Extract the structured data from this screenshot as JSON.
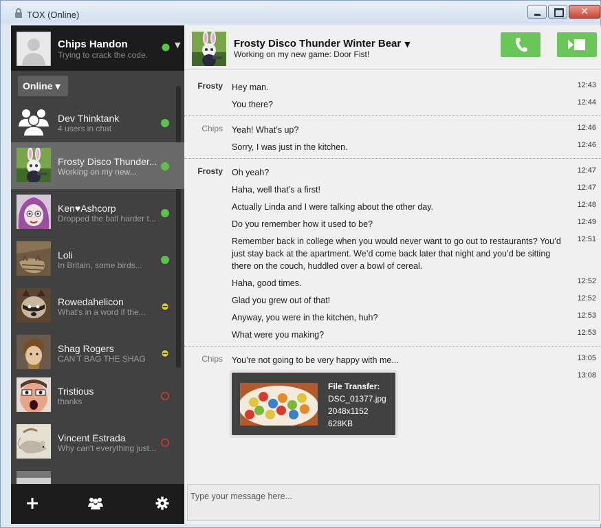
{
  "window": {
    "title": "TOX (Online)"
  },
  "self": {
    "name": "Chips Handon",
    "status": "Trying to crack the code.",
    "status_color": "#5cc24a"
  },
  "status_dropdown": {
    "label": "Online ▾"
  },
  "friends": [
    {
      "name": "Dev Thinktank",
      "status": "4 users in chat",
      "dot": "online",
      "avatar": "group-avatar"
    },
    {
      "name": "Frosty Disco Thunder...",
      "status": "Working on my new...",
      "dot": "online",
      "avatar": "bunny-avatar"
    },
    {
      "name": "Ken♥Ashcorp",
      "status": "Dropped the ball harder t...",
      "dot": "online",
      "avatar": "anime-avatar"
    },
    {
      "name": "Loli",
      "status": "In Britain, some birds...",
      "dot": "online",
      "avatar": "cat-avatar"
    },
    {
      "name": "Rowedahelicon",
      "status": "What's in a word if the...",
      "dot": "away",
      "avatar": "raccoon-avatar"
    },
    {
      "name": "Shag Rogers",
      "status": "CAN'T BAG THE SHAG",
      "dot": "away",
      "avatar": "shaggy-avatar"
    },
    {
      "name": "Tristious",
      "status": "thanks",
      "dot": "busy",
      "avatar": "face-avatar"
    },
    {
      "name": "Vincent Estrada",
      "status": "Why can't everything just...",
      "dot": "busy",
      "avatar": "mouse-avatar"
    }
  ],
  "colors": {
    "online": "#5cc24a",
    "away": "#e3cf2b",
    "busy": "#c9393b",
    "accent": "#6bc65a"
  },
  "chat": {
    "name": "Frosty Disco Thunder Winter Bear",
    "status": "Working on my new game: Door Fist!"
  },
  "messages": [
    {
      "who": "Frosty",
      "text": "Hey man.",
      "time": "12:43"
    },
    {
      "who": "",
      "text": "You there?",
      "time": "12:44"
    },
    {
      "who": "Chips",
      "text": "Yeah! What’s up?",
      "time": "12:46"
    },
    {
      "who": "",
      "text": "Sorry, I was just in the kitchen.",
      "time": "12:46"
    },
    {
      "who": "Frosty",
      "text": "Oh yeah?",
      "time": "12:47"
    },
    {
      "who": "",
      "text": "Haha, well that’s a first!",
      "time": "12:47"
    },
    {
      "who": "",
      "text": "Actually Linda and I were talking about the other day.",
      "time": "12:48"
    },
    {
      "who": "",
      "text": "Do you remember how it used to be?",
      "time": "12:49"
    },
    {
      "who": "",
      "text": "Remember back in college when you would never want to go out to restaurants? You’d just stay back at the apartment. We’d come back later that night and you’d be sitting there on the couch, huddled over a bowl of cereal.",
      "time": "12:51"
    },
    {
      "who": "",
      "text": "Haha, good times.",
      "time": "12:52"
    },
    {
      "who": "",
      "text": "Glad you grew out of that!",
      "time": "12:52"
    },
    {
      "who": "",
      "text": "Anyway, you were in the kitchen, huh?",
      "time": "12:53"
    },
    {
      "who": "",
      "text": "What were you making?",
      "time": "12:53"
    },
    {
      "who": "Chips",
      "text": "You’re not going to be very happy with me...",
      "time": "13:05"
    },
    {
      "who": "",
      "text": "",
      "time": "13:08"
    }
  ],
  "file_transfer": {
    "title": "File Transfer:",
    "filename": "DSC_01377.jpg",
    "dimensions": "2048x1152",
    "size": "628KB"
  },
  "input": {
    "placeholder": "Type your message here..."
  }
}
